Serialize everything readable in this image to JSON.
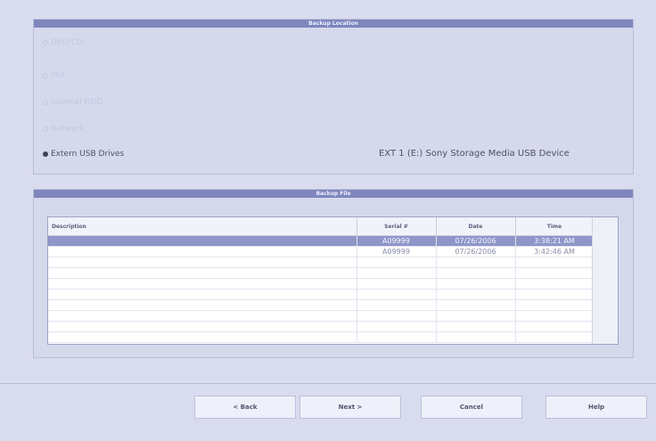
{
  "backup_location": {
    "title": "Backup Location",
    "options": [
      {
        "label": "DVD/CD",
        "selected": false,
        "enabled": false
      },
      {
        "label": "MO",
        "selected": false,
        "enabled": false
      },
      {
        "label": "Internal HDD",
        "selected": false,
        "enabled": false
      },
      {
        "label": "Network",
        "selected": false,
        "enabled": false
      },
      {
        "label": "Extern USB Drives",
        "selected": true,
        "enabled": true
      }
    ],
    "device_text": "EXT 1 (E:) Sony Storage Media USB Device"
  },
  "backup_file": {
    "title": "Backup File",
    "columns": [
      "Description",
      "Serial #",
      "Date",
      "Time"
    ],
    "rows": [
      {
        "description": "",
        "serial": "A09999",
        "date": "07/26/2006",
        "time": "3:38:21 AM",
        "selected": true
      },
      {
        "description": "",
        "serial": "A09999",
        "date": "07/26/2006",
        "time": "3:42:46 AM",
        "selected": false
      }
    ]
  },
  "buttons": {
    "back": "< Back",
    "next": "Next >",
    "cancel": "Cancel",
    "help": "Help"
  }
}
